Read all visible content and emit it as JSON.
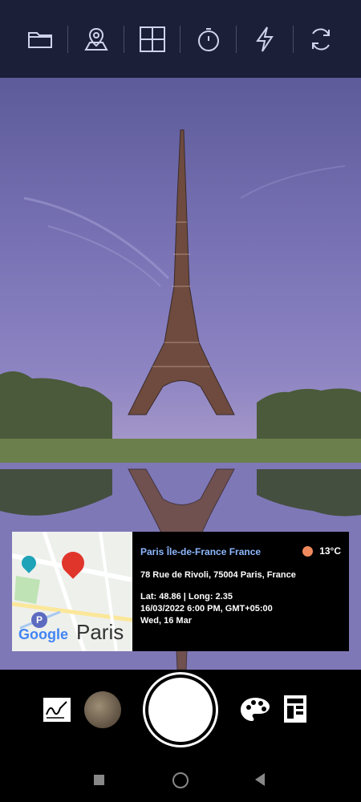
{
  "toolbar": {
    "items": [
      {
        "icon": "folder-icon",
        "label": ""
      },
      {
        "icon": "map-pin-icon",
        "label": ""
      },
      {
        "icon": "grid-icon",
        "label": ""
      },
      {
        "icon": "timer-icon",
        "label": ""
      },
      {
        "icon": "flash-icon",
        "label": ""
      },
      {
        "icon": "switch-camera-icon",
        "label": ""
      }
    ]
  },
  "overlay": {
    "map_label": "Paris",
    "map_brand": "Google",
    "location_title": "Paris Île-de-France France",
    "temperature": "13°C",
    "address": "78 Rue de Rivoli, 75004 Paris, France",
    "coords": "Lat: 48.86 | Long: 2.35",
    "datetime": "16/03/2022  6:00 PM, GMT+05:00",
    "day": "Wed, 16 Mar"
  },
  "bottom": {
    "signature_icon": "signature-icon",
    "palette_icon": "palette-icon",
    "template_icon": "template-icon"
  },
  "colors": {
    "topbar": "#1c1f38",
    "accent_blue": "#8db7ff",
    "temp_dot": "#f08a5d"
  }
}
